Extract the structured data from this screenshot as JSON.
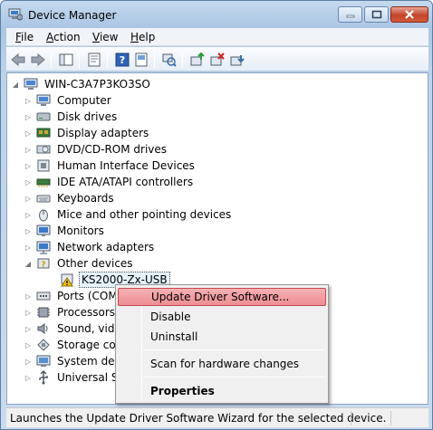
{
  "window": {
    "title": "Device Manager"
  },
  "menu": [
    {
      "label": "File",
      "accel": "F",
      "rest": "ile"
    },
    {
      "label": "Action",
      "accel": "A",
      "rest": "ction"
    },
    {
      "label": "View",
      "accel": "V",
      "rest": "iew"
    },
    {
      "label": "Help",
      "accel": "H",
      "rest": "elp"
    }
  ],
  "toolbar": {
    "buttons": [
      "back-icon",
      "forward-icon",
      "show-hide-tree-icon",
      "properties-icon",
      "help-icon",
      "view-icon",
      "scan-hardware-icon",
      "update-driver-icon",
      "uninstall-icon",
      "disable-icon"
    ]
  },
  "tree": {
    "root": "WIN-C3A7P3KO3SO",
    "categories": [
      {
        "label": "Computer",
        "icon": "computer-icon"
      },
      {
        "label": "Disk drives",
        "icon": "disk-drive-icon"
      },
      {
        "label": "Display adapters",
        "icon": "display-adapter-icon"
      },
      {
        "label": "DVD/CD-ROM drives",
        "icon": "dvd-drive-icon"
      },
      {
        "label": "Human Interface Devices",
        "icon": "hid-icon"
      },
      {
        "label": "IDE ATA/ATAPI controllers",
        "icon": "ide-controller-icon"
      },
      {
        "label": "Keyboards",
        "icon": "keyboard-icon"
      },
      {
        "label": "Mice and other pointing devices",
        "icon": "mouse-icon"
      },
      {
        "label": "Monitors",
        "icon": "monitor-icon"
      },
      {
        "label": "Network adapters",
        "icon": "network-adapter-icon"
      },
      {
        "label": "Other devices",
        "icon": "other-devices-icon"
      }
    ],
    "child_device": "KS2000-Zx-USB",
    "after": [
      {
        "label": "Ports (COM",
        "icon": "ports-icon"
      },
      {
        "label": "Processors",
        "icon": "processor-icon"
      },
      {
        "label": "Sound, vide",
        "icon": "sound-icon"
      },
      {
        "label": "Storage cor",
        "icon": "storage-controller-icon"
      },
      {
        "label": "System dev",
        "icon": "system-devices-icon"
      },
      {
        "label": "Universal Se",
        "icon": "usb-controller-icon"
      }
    ]
  },
  "context_menu": {
    "items": [
      "Update Driver Software...",
      "Disable",
      "Uninstall",
      "Scan for hardware changes",
      "Properties"
    ]
  },
  "status": {
    "text": "Launches the Update Driver Software Wizard for the selected device."
  }
}
